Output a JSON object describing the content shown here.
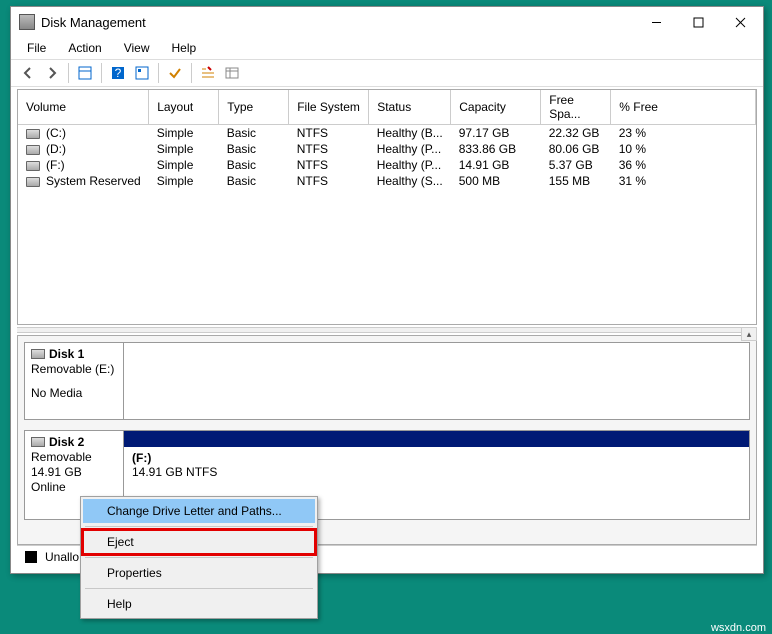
{
  "window": {
    "title": "Disk Management"
  },
  "menus": [
    "File",
    "Action",
    "View",
    "Help"
  ],
  "columns": [
    "Volume",
    "Layout",
    "Type",
    "File System",
    "Status",
    "Capacity",
    "Free Spa...",
    "% Free"
  ],
  "volumes": [
    {
      "name": "(C:)",
      "layout": "Simple",
      "type": "Basic",
      "fs": "NTFS",
      "status": "Healthy (B...",
      "cap": "97.17 GB",
      "free": "22.32 GB",
      "pct": "23 %"
    },
    {
      "name": "(D:)",
      "layout": "Simple",
      "type": "Basic",
      "fs": "NTFS",
      "status": "Healthy (P...",
      "cap": "833.86 GB",
      "free": "80.06 GB",
      "pct": "10 %"
    },
    {
      "name": "(F:)",
      "layout": "Simple",
      "type": "Basic",
      "fs": "NTFS",
      "status": "Healthy (P...",
      "cap": "14.91 GB",
      "free": "5.37 GB",
      "pct": "36 %"
    },
    {
      "name": "System Reserved",
      "layout": "Simple",
      "type": "Basic",
      "fs": "NTFS",
      "status": "Healthy (S...",
      "cap": "500 MB",
      "free": "155 MB",
      "pct": "31 %"
    }
  ],
  "disk1": {
    "name": "Disk 1",
    "type": "Removable (E:)",
    "media": "No Media"
  },
  "disk2": {
    "name": "Disk 2",
    "type": "Removable",
    "size": "14.91 GB",
    "state": "Online",
    "part_label": "(F:)",
    "part_info": "14.91 GB NTFS"
  },
  "statusbar": {
    "unalloc": "Unallo"
  },
  "context_menu": {
    "change": "Change Drive Letter and Paths...",
    "eject": "Eject",
    "properties": "Properties",
    "help": "Help"
  },
  "attribution": "wsxdn.com"
}
